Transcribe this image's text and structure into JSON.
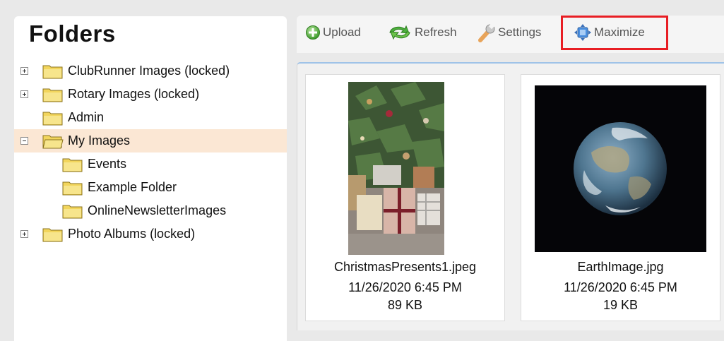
{
  "folders_panel": {
    "title": "Folders",
    "tree": [
      {
        "label": "ClubRunner Images (locked)",
        "toggle": "plus",
        "level": 0,
        "selected": false
      },
      {
        "label": "Rotary Images (locked)",
        "toggle": "plus",
        "level": 0,
        "selected": false
      },
      {
        "label": "Admin",
        "toggle": "none",
        "level": 0,
        "selected": false
      },
      {
        "label": "My Images",
        "toggle": "minus",
        "level": 0,
        "selected": true,
        "open": true
      },
      {
        "label": "Events",
        "toggle": "none",
        "level": 1,
        "selected": false
      },
      {
        "label": "Example Folder",
        "toggle": "none",
        "level": 1,
        "selected": false
      },
      {
        "label": "OnlineNewsletterImages",
        "toggle": "none",
        "level": 1,
        "selected": false
      },
      {
        "label": "Photo Albums (locked)",
        "toggle": "plus",
        "level": 0,
        "selected": false
      }
    ]
  },
  "toolbar": {
    "upload_label": "Upload",
    "refresh_label": "Refresh",
    "settings_label": "Settings",
    "maximize_label": "Maximize"
  },
  "images": [
    {
      "filename": "ChristmasPresents1.jpeg",
      "date": "11/26/2020 6:45 PM",
      "size": "89 KB",
      "thumb": "christmas-tree-presents-photo"
    },
    {
      "filename": "EarthImage.jpg",
      "date": "11/26/2020 6:45 PM",
      "size": "19 KB",
      "thumb": "earth-photo"
    }
  ],
  "colors": {
    "selected_row": "#fbe7d4",
    "highlight_border": "#e81e24",
    "folder_yellow": "#f2d55c"
  }
}
